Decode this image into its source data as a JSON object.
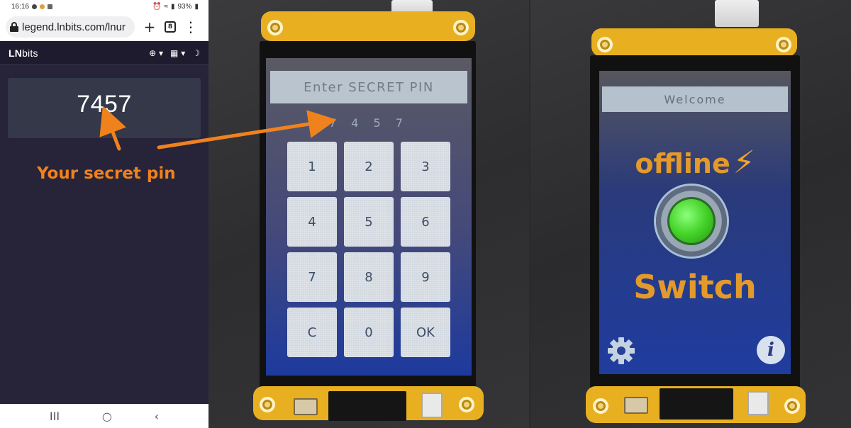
{
  "phone": {
    "status": {
      "time": "16:16",
      "battery": "93%"
    },
    "browser": {
      "url": "legend.lnbits.com/lnur",
      "new_tab_icon": "+",
      "tab_count": "8",
      "menu_icon": "⋮"
    },
    "app": {
      "title_bold": "LN",
      "title_light": "bits",
      "icons": [
        "globe-icon",
        "grid-icon",
        "moon-icon"
      ]
    },
    "pin": "7457",
    "annotation": "Your secret pin",
    "nav": {
      "recent": "III",
      "home": "○",
      "back": "‹"
    }
  },
  "keypad_screen": {
    "header": "Enter SECRET PIN",
    "entered": "7457",
    "keys": [
      "1",
      "2",
      "3",
      "4",
      "5",
      "6",
      "7",
      "8",
      "9",
      "C",
      "0",
      "OK"
    ]
  },
  "main_screen": {
    "header": "Welcome",
    "status": "offline",
    "status_icon": "lightning-bolt-icon",
    "button_label": "Switch",
    "button_color": "#46d42a",
    "settings_icon": "gear-icon",
    "info_icon": "i"
  },
  "colors": {
    "accent": "#f0821d",
    "lnbits_bg": "#272339",
    "switch_orange": "#e39a2a"
  }
}
